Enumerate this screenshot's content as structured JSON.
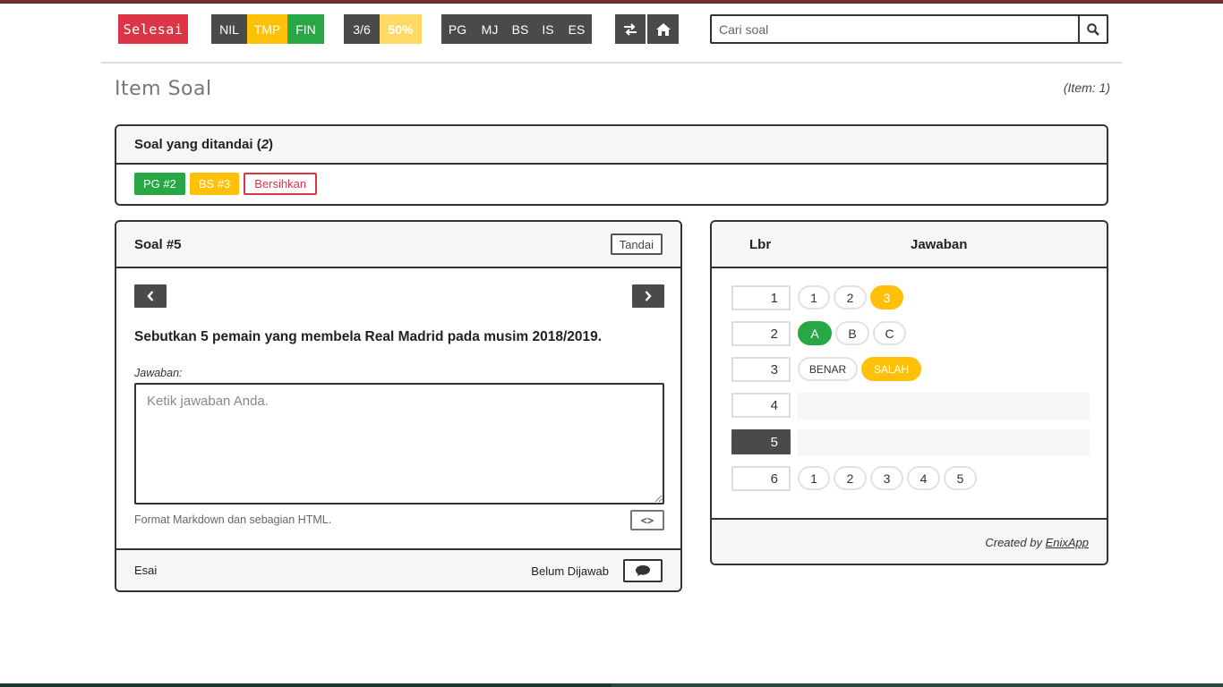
{
  "toolbar": {
    "finish_label": "Selesai",
    "status_filters": [
      "NIL",
      "TMP",
      "FIN"
    ],
    "progress_count": "3/6",
    "progress_percent": "50%",
    "type_filters": [
      "PG",
      "MJ",
      "BS",
      "IS",
      "ES"
    ],
    "shuffle_icon": "swap-arrows-icon",
    "home_icon": "home-icon"
  },
  "search": {
    "placeholder": "Cari soal",
    "icon": "search-icon"
  },
  "page": {
    "title": "Item Soal",
    "item_count": "(Item: 1)"
  },
  "marked": {
    "title": "Soal yang ditandai (",
    "count": "2",
    "title_end": ")",
    "tags": [
      "PG #2",
      "BS #3"
    ],
    "clear_label": "Bersihkan"
  },
  "question": {
    "title": "Soal #5",
    "mark_label": "Tandai",
    "text": "Sebutkan 5 pemain yang membela Real Madrid pada musim 2018/2019.",
    "answer_label": "Jawaban:",
    "answer_placeholder": "Ketik jawaban Anda.",
    "answer_value": "",
    "format_note": "Format Markdown dan sebagian HTML.",
    "code_label": "<>",
    "type_label": "Esai",
    "status_label": "Belum Dijawab"
  },
  "answer_sheet": {
    "col_number": "Lbr",
    "col_answer": "Jawaban",
    "rows": [
      {
        "number": "1",
        "options": [
          "1",
          "2",
          "3"
        ],
        "selected": "3"
      },
      {
        "number": "2",
        "options": [
          "A",
          "B",
          "C"
        ],
        "selected": "A"
      },
      {
        "number": "3",
        "options": [
          "BENAR",
          "SALAH"
        ],
        "selected": "SALAH"
      },
      {
        "number": "4",
        "options": [],
        "selected": ""
      },
      {
        "number": "5",
        "options": [],
        "selected": "",
        "current": true
      },
      {
        "number": "6",
        "options": [
          "1",
          "2",
          "3",
          "4",
          "5"
        ],
        "selected": ""
      }
    ],
    "credit_prefix": "Created by",
    "credit_link": "EnixApp"
  },
  "colors": {
    "red": "#dc3545",
    "dark": "#4a4a4a",
    "yellow": "#ffc107",
    "green": "#28a745"
  },
  "progress_fraction": 0.5
}
